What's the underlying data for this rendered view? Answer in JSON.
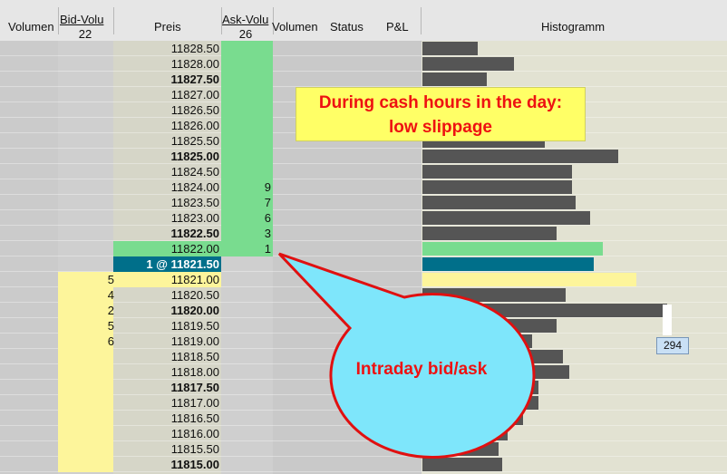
{
  "header": {
    "col_volumen_left": "Volumen",
    "col_bid": "Bid-Volu",
    "col_bid_sub": "22",
    "col_preis": "Preis",
    "col_ask": "Ask-Volu",
    "col_ask_sub": "26",
    "col_volumen_right": "Volumen",
    "col_status": "Status",
    "col_pl": "P&L",
    "col_histogramm": "Histogramm"
  },
  "rows": [
    {
      "price": "11828.50",
      "bold": false,
      "ask": "",
      "bid": "",
      "ask_fill": true,
      "bid_fill": false,
      "bar": 0.18
    },
    {
      "price": "11828.00",
      "bold": false,
      "ask": "",
      "bid": "",
      "ask_fill": true,
      "bid_fill": false,
      "bar": 0.3
    },
    {
      "price": "11827.50",
      "bold": true,
      "ask": "",
      "bid": "",
      "ask_fill": true,
      "bid_fill": false,
      "bar": 0.21
    },
    {
      "price": "11827.00",
      "bold": false,
      "ask": "",
      "bid": "",
      "ask_fill": true,
      "bid_fill": false,
      "bar": 0
    },
    {
      "price": "11826.50",
      "bold": false,
      "ask": "",
      "bid": "",
      "ask_fill": true,
      "bid_fill": false,
      "bar": 0
    },
    {
      "price": "11826.00",
      "bold": false,
      "ask": "",
      "bid": "",
      "ask_fill": true,
      "bid_fill": false,
      "bar": 0
    },
    {
      "price": "11825.50",
      "bold": false,
      "ask": "",
      "bid": "",
      "ask_fill": true,
      "bid_fill": false,
      "bar": 0.4
    },
    {
      "price": "11825.00",
      "bold": true,
      "ask": "",
      "bid": "",
      "ask_fill": true,
      "bid_fill": false,
      "bar": 0.64
    },
    {
      "price": "11824.50",
      "bold": false,
      "ask": "",
      "bid": "",
      "ask_fill": true,
      "bid_fill": false,
      "bar": 0.49
    },
    {
      "price": "11824.00",
      "bold": false,
      "ask": "9",
      "bid": "",
      "ask_fill": true,
      "bid_fill": false,
      "bar": 0.49
    },
    {
      "price": "11823.50",
      "bold": false,
      "ask": "7",
      "bid": "",
      "ask_fill": true,
      "bid_fill": false,
      "bar": 0.5
    },
    {
      "price": "11823.00",
      "bold": false,
      "ask": "6",
      "bid": "",
      "ask_fill": true,
      "bid_fill": false,
      "bar": 0.55
    },
    {
      "price": "11822.50",
      "bold": true,
      "ask": "3",
      "bid": "",
      "ask_fill": true,
      "bid_fill": false,
      "bar": 0.44
    },
    {
      "price": "11822.00",
      "bold": false,
      "ask": "1",
      "bid": "",
      "ask_fill": true,
      "bid_fill": false,
      "bar": 0.59,
      "row_style": "green"
    },
    {
      "price": "1 @ 11821.50",
      "bold": true,
      "ask": "",
      "bid": "",
      "ask_fill": false,
      "bid_fill": false,
      "bar": 0.56,
      "row_style": "teal"
    },
    {
      "price": "11821.00",
      "bold": false,
      "ask": "",
      "bid": "5",
      "ask_fill": false,
      "bid_fill": true,
      "bar": 0.7,
      "row_style": "yellow"
    },
    {
      "price": "11820.50",
      "bold": false,
      "ask": "",
      "bid": "4",
      "ask_fill": false,
      "bid_fill": true,
      "bar": 0.47
    },
    {
      "price": "11820.00",
      "bold": true,
      "ask": "",
      "bid": "2",
      "ask_fill": false,
      "bid_fill": true,
      "bar": 0.8
    },
    {
      "price": "11819.50",
      "bold": false,
      "ask": "",
      "bid": "5",
      "ask_fill": false,
      "bid_fill": true,
      "bar": 0.44
    },
    {
      "price": "11819.00",
      "bold": false,
      "ask": "",
      "bid": "6",
      "ask_fill": false,
      "bid_fill": true,
      "bar": 0.36
    },
    {
      "price": "11818.50",
      "bold": false,
      "ask": "",
      "bid": "",
      "ask_fill": false,
      "bid_fill": true,
      "bar": 0.46
    },
    {
      "price": "11818.00",
      "bold": false,
      "ask": "",
      "bid": "",
      "ask_fill": false,
      "bid_fill": true,
      "bar": 0.48
    },
    {
      "price": "11817.50",
      "bold": true,
      "ask": "",
      "bid": "",
      "ask_fill": false,
      "bid_fill": true,
      "bar": 0.38
    },
    {
      "price": "11817.00",
      "bold": false,
      "ask": "",
      "bid": "",
      "ask_fill": false,
      "bid_fill": true,
      "bar": 0.38
    },
    {
      "price": "11816.50",
      "bold": false,
      "ask": "",
      "bid": "",
      "ask_fill": false,
      "bid_fill": true,
      "bar": 0.33
    },
    {
      "price": "11816.00",
      "bold": false,
      "ask": "",
      "bid": "",
      "ask_fill": false,
      "bid_fill": true,
      "bar": 0.28
    },
    {
      "price": "11815.50",
      "bold": false,
      "ask": "",
      "bid": "",
      "ask_fill": false,
      "bid_fill": true,
      "bar": 0.25
    },
    {
      "price": "11815.00",
      "bold": true,
      "ask": "",
      "bid": "",
      "ask_fill": false,
      "bid_fill": true,
      "bar": 0.26
    }
  ],
  "annotations": {
    "cash_hours_line1": "During cash hours in the day:",
    "cash_hours_line2": "low slippage",
    "intraday_label": "Intraday bid/ask"
  },
  "tooltip": {
    "value": "294"
  },
  "colors": {
    "ask_green": "#79dc8f",
    "bid_yellow": "#fdf59b",
    "last_trade_teal": "#006f8a",
    "histogram_bar": "#555555",
    "annotation_red": "#ee1111",
    "callout_fill": "#7ee6fb"
  }
}
